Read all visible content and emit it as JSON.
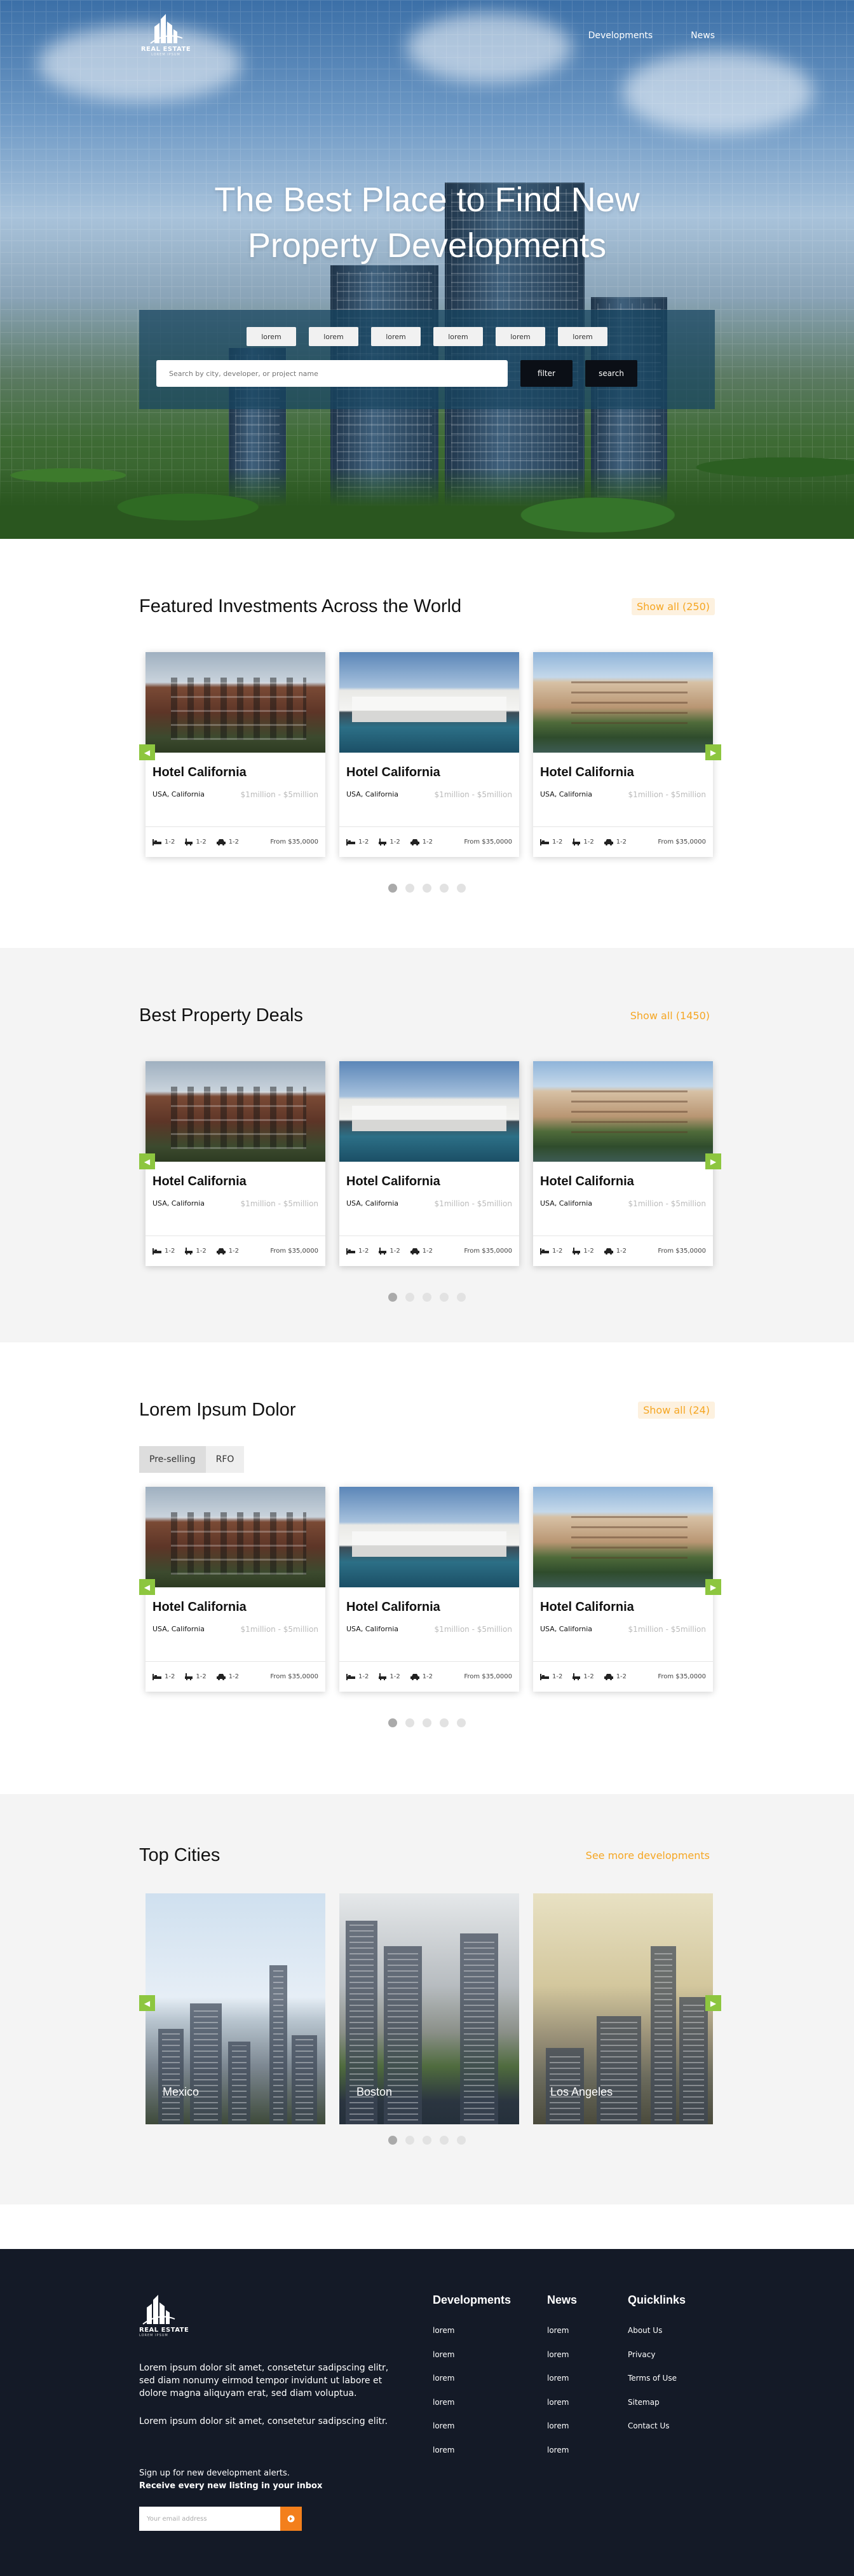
{
  "brand": {
    "name": "REAL ESTATE",
    "tagline": "LOREM IPSUM"
  },
  "nav": {
    "items": [
      "Developments",
      "News"
    ]
  },
  "hero": {
    "title_line1": "The Best Place to Find New",
    "title_line2": "Property Developments",
    "chips": [
      "lorem",
      "lorem",
      "lorem",
      "lorem",
      "lorem",
      "lorem"
    ],
    "search_placeholder": "Search by city, developer, or project name",
    "filter_label": "filter",
    "search_label": "search"
  },
  "card_template": {
    "title": "Hotel California",
    "location": "USA, California",
    "price_range": "$1million - $5million",
    "beds": "1-2",
    "baths": "1-2",
    "parking": "1-2",
    "from": "From $35,0000"
  },
  "sections": {
    "featured": {
      "title": "Featured Investments Across the World",
      "link": "Show all (250)"
    },
    "deals": {
      "title": "Best Property Deals",
      "link": "Show all (1450)"
    },
    "lorem": {
      "title": "Lorem Ipsum Dolor",
      "link": "Show all (24)",
      "tabs": [
        "Pre-selling",
        "RFO"
      ]
    },
    "cities": {
      "title": "Top Cities",
      "link": "See more developments",
      "items": [
        "Mexico",
        "Boston",
        "Los Angeles"
      ]
    }
  },
  "footer": {
    "about_1": "Lorem ipsum dolor sit amet, consetetur sadipscing elitr, sed diam nonumy eirmod tempor invidunt ut labore et dolore magna aliquyam erat, sed diam voluptua.",
    "about_2": "Lorem ipsum dolor sit amet, consetetur sadipscing elitr.",
    "newsletter_line1": "Sign up for new development alerts.",
    "newsletter_line2": "Receive every new listing in your inbox",
    "email_placeholder": "Your email address",
    "col_developments": {
      "title": "Developments",
      "links": [
        "lorem",
        "lorem",
        "lorem",
        "lorem",
        "lorem",
        "lorem"
      ]
    },
    "col_news": {
      "title": "News",
      "links": [
        "lorem",
        "lorem",
        "lorem",
        "lorem",
        "lorem",
        "lorem"
      ]
    },
    "col_quicklinks": {
      "title": "Quicklinks",
      "links": [
        "About Us",
        "Privacy",
        "Terms of Use",
        "Sitemap",
        "Contact Us"
      ]
    }
  },
  "colors": {
    "accent_green": "#8dc63f",
    "accent_orange": "#f5a623",
    "footer_bg": "#141a27"
  }
}
